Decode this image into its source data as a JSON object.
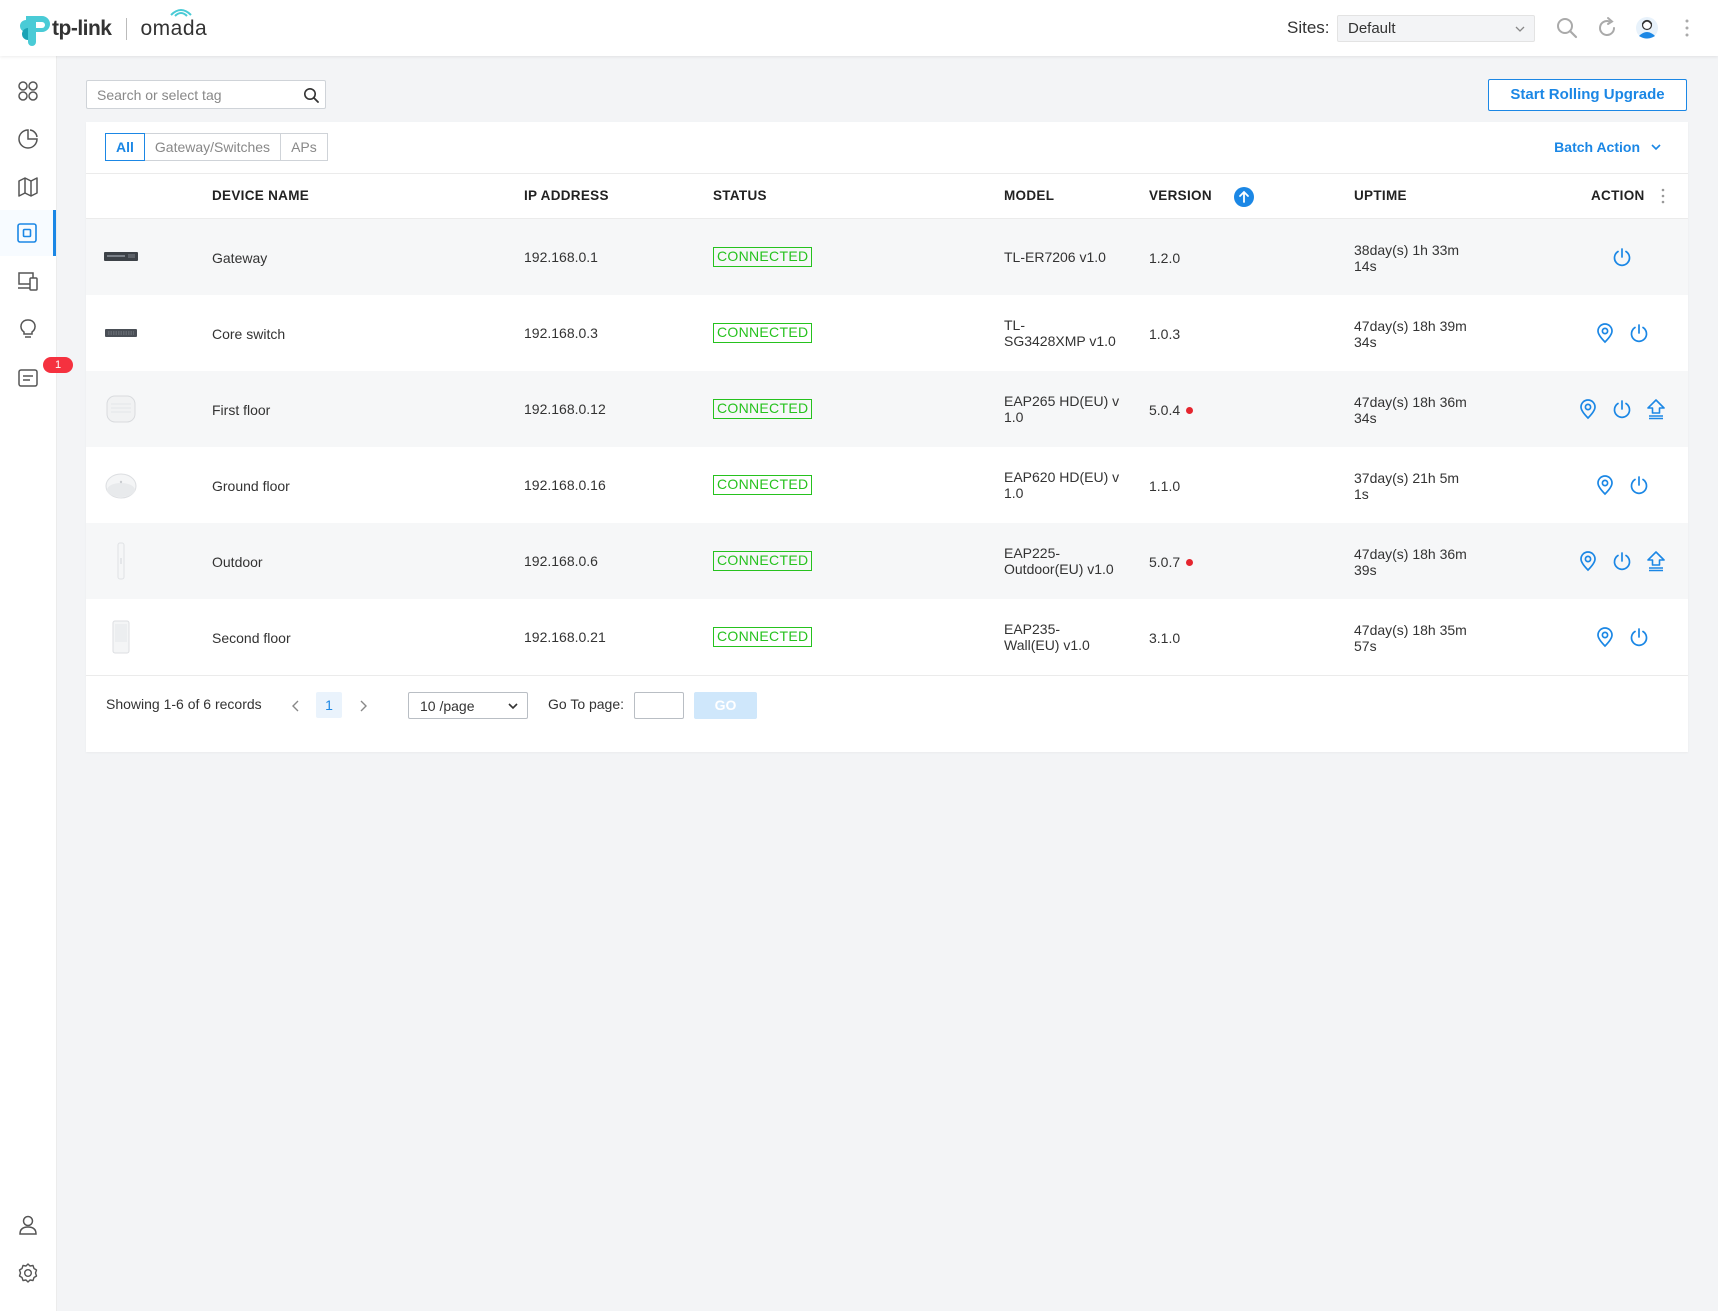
{
  "header": {
    "brand": "tp-link",
    "product": "omada",
    "sites_label": "Sites:",
    "site_selected": "Default",
    "icons": [
      "search-icon",
      "refresh-icon",
      "user-avatar-icon",
      "more-vertical-icon"
    ]
  },
  "sidebar": {
    "items": [
      {
        "name": "dashboard",
        "icon": "dashboard-grid-icon"
      },
      {
        "name": "statistics",
        "icon": "pie-chart-icon"
      },
      {
        "name": "map",
        "icon": "map-icon"
      },
      {
        "name": "devices",
        "icon": "devices-icon",
        "active": true
      },
      {
        "name": "clients",
        "icon": "clients-icon"
      },
      {
        "name": "insight",
        "icon": "lightbulb-icon"
      },
      {
        "name": "logs",
        "icon": "logs-icon",
        "badge": "1"
      }
    ],
    "bottom_items": [
      {
        "name": "account",
        "icon": "user-icon"
      },
      {
        "name": "settings",
        "icon": "gear-icon"
      }
    ]
  },
  "toolbar": {
    "search_placeholder": "Search or select tag",
    "rolling_upgrade_label": "Start Rolling Upgrade"
  },
  "filter_tabs": [
    "All",
    "Gateway/Switches",
    "APs"
  ],
  "batch_action_label": "Batch Action",
  "table": {
    "columns": {
      "device_name": "DEVICE NAME",
      "ip": "IP ADDRESS",
      "status": "STATUS",
      "model": "MODEL",
      "version": "VERSION",
      "uptime": "UPTIME",
      "action": "ACTION"
    },
    "rows": [
      {
        "device_type": "gateway",
        "name": "Gateway",
        "ip": "192.168.0.1",
        "status": "CONNECTED",
        "model_lines": [
          "TL-ER7206 v1.0",
          ""
        ],
        "version": "1.2.0",
        "upgrade_available": false,
        "uptime_lines": [
          "38day(s) 1h 33m",
          "14s"
        ],
        "actions": [
          "reboot-icon"
        ]
      },
      {
        "device_type": "switch",
        "name": "Core switch",
        "ip": "192.168.0.3",
        "status": "CONNECTED",
        "model_lines": [
          "TL-",
          "SG3428XMP v1.0"
        ],
        "version": "1.0.3",
        "upgrade_available": false,
        "uptime_lines": [
          "47day(s) 18h 39m",
          "34s"
        ],
        "actions": [
          "locate-icon",
          "reboot-icon"
        ]
      },
      {
        "device_type": "ap-ceiling-square",
        "name": "First floor",
        "ip": "192.168.0.12",
        "status": "CONNECTED",
        "model_lines": [
          "EAP265 HD(EU) v",
          "1.0"
        ],
        "version": "5.0.4",
        "upgrade_available": true,
        "uptime_lines": [
          "47day(s) 18h 36m",
          "34s"
        ],
        "actions": [
          "locate-icon",
          "reboot-icon",
          "upgrade-icon"
        ]
      },
      {
        "device_type": "ap-ceiling-round",
        "name": "Ground floor",
        "ip": "192.168.0.16",
        "status": "CONNECTED",
        "model_lines": [
          "EAP620 HD(EU) v",
          "1.0"
        ],
        "version": "1.1.0",
        "upgrade_available": false,
        "uptime_lines": [
          "37day(s) 21h 5m",
          "1s"
        ],
        "actions": [
          "locate-icon",
          "reboot-icon"
        ]
      },
      {
        "device_type": "ap-outdoor",
        "name": "Outdoor",
        "ip": "192.168.0.6",
        "status": "CONNECTED",
        "model_lines": [
          "EAP225-",
          "Outdoor(EU) v1.0"
        ],
        "version": "5.0.7",
        "upgrade_available": true,
        "uptime_lines": [
          "47day(s) 18h 36m",
          "39s"
        ],
        "actions": [
          "locate-icon",
          "reboot-icon",
          "upgrade-icon"
        ]
      },
      {
        "device_type": "ap-wall",
        "name": "Second floor",
        "ip": "192.168.0.21",
        "status": "CONNECTED",
        "model_lines": [
          "EAP235-",
          "Wall(EU) v1.0"
        ],
        "version": "3.1.0",
        "upgrade_available": false,
        "uptime_lines": [
          "47day(s) 18h 35m",
          "57s"
        ],
        "actions": [
          "locate-icon",
          "reboot-icon"
        ]
      }
    ]
  },
  "pagination": {
    "records_text": "Showing 1-6 of 6 records",
    "current_page": "1",
    "per_page": "10 /page",
    "goto_label": "Go To page:",
    "go_label": "GO"
  },
  "colors": {
    "accent": "#1b87e5",
    "connected": "#26c21e",
    "alert": "#e5252e",
    "badge": "#f5313f"
  }
}
